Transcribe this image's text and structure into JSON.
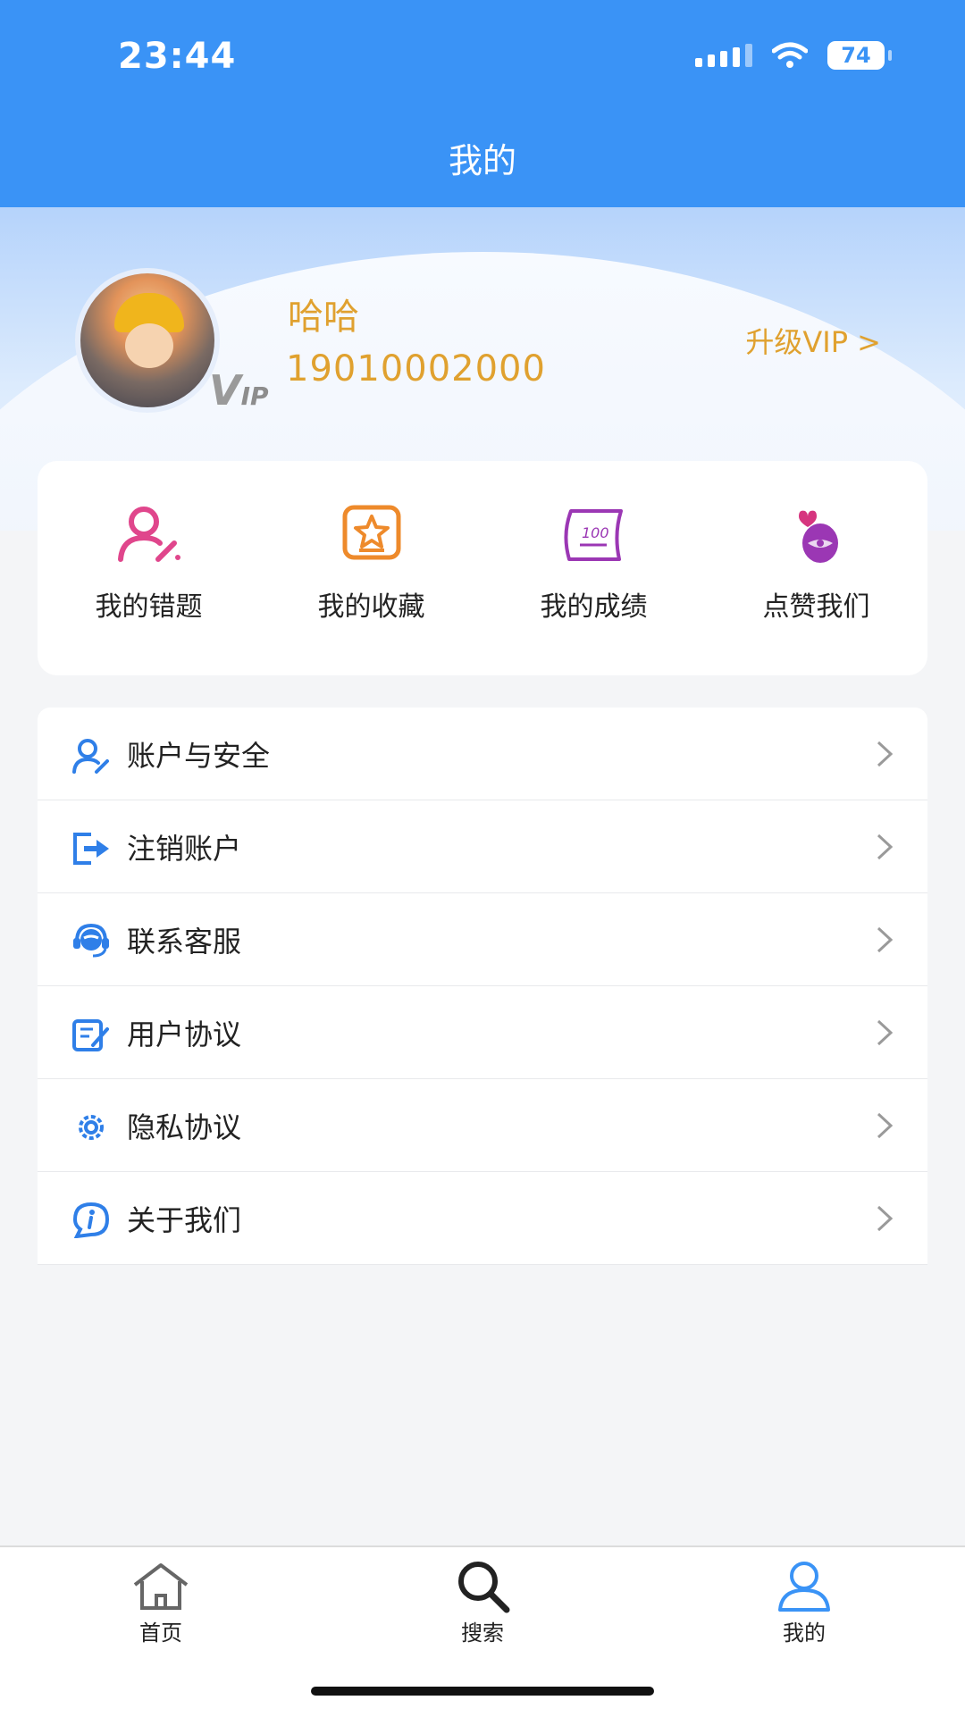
{
  "status_bar": {
    "time": "23:44",
    "battery": "74"
  },
  "nav": {
    "title": "我的"
  },
  "profile": {
    "name": "哈哈",
    "phone": "19010002000",
    "vip_badge_v": "V",
    "vip_badge_ip": "IP",
    "upgrade": "升级VIP >"
  },
  "quick_actions": [
    {
      "label": "我的错题",
      "icon": "user-edit-icon"
    },
    {
      "label": "我的收藏",
      "icon": "star-box-icon"
    },
    {
      "label": "我的成绩",
      "icon": "score-scroll-icon"
    },
    {
      "label": "点赞我们",
      "icon": "like-icon"
    }
  ],
  "menu": [
    {
      "label": "账户与安全",
      "icon": "user-security-icon"
    },
    {
      "label": "注销账户",
      "icon": "logout-icon"
    },
    {
      "label": "联系客服",
      "icon": "customer-service-icon"
    },
    {
      "label": "用户协议",
      "icon": "agreement-icon"
    },
    {
      "label": "隐私协议",
      "icon": "gear-icon"
    },
    {
      "label": "关于我们",
      "icon": "info-icon"
    }
  ],
  "tabs": [
    {
      "label": "首页",
      "icon": "home-icon"
    },
    {
      "label": "搜索",
      "icon": "search-icon"
    },
    {
      "label": "我的",
      "icon": "profile-icon"
    }
  ],
  "colors": {
    "primary": "#3a93f6",
    "accent": "#e0a12f",
    "pink": "#e0468c",
    "orange": "#ee8a2b",
    "purple": "#9b37b4"
  }
}
